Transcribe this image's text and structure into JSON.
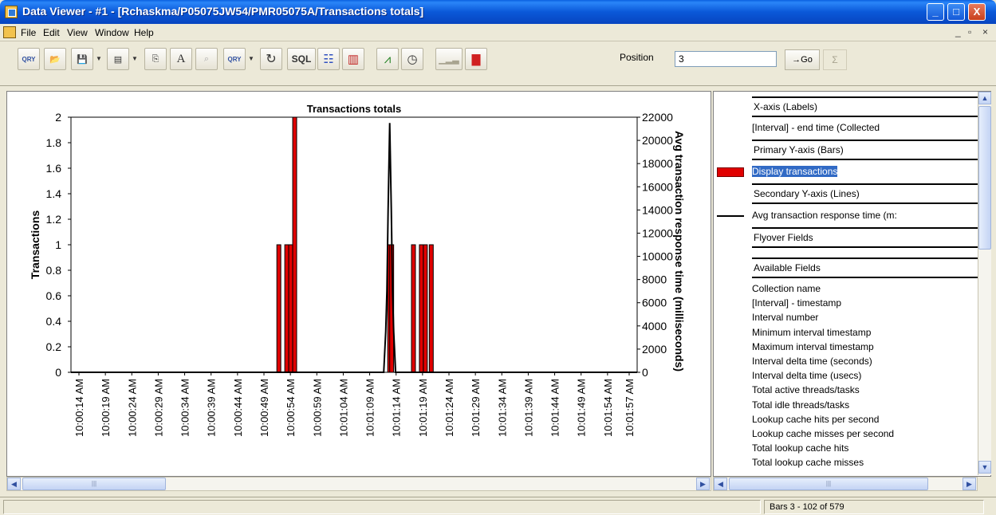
{
  "window": {
    "title": "Data Viewer - #1 - [Rchaskma/P05075JW54/PMR05075A/Transactions totals]",
    "minimize_glyph": "_",
    "maximize_glyph": "□",
    "close_glyph": "X"
  },
  "menu": {
    "items": [
      "File",
      "Edit",
      "View",
      "Window",
      "Help"
    ],
    "mdi_controls": [
      "_",
      "▫",
      "×"
    ]
  },
  "toolbar": {
    "buttons": [
      {
        "name": "query-button",
        "glyph": "QRY"
      },
      {
        "name": "open-button",
        "glyph": "📂"
      },
      {
        "name": "save-button",
        "glyph": "💾"
      },
      {
        "name": "properties-button",
        "glyph": "▤"
      },
      {
        "name": "copy-button",
        "glyph": "⎘"
      },
      {
        "name": "font-button",
        "glyph": "A"
      },
      {
        "name": "find-button",
        "glyph": "⌕"
      },
      {
        "name": "query-options-button",
        "glyph": "QRY"
      },
      {
        "name": "refresh-button",
        "glyph": "↻"
      },
      {
        "name": "sql-button",
        "glyph": "SQL"
      },
      {
        "name": "table-view-button",
        "glyph": "☷"
      },
      {
        "name": "bar-chart-button",
        "glyph": "▥"
      },
      {
        "name": "line-chart-button",
        "glyph": "⩘"
      },
      {
        "name": "time-button",
        "glyph": "◷"
      },
      {
        "name": "histogram-button",
        "glyph": "▁▂▃"
      },
      {
        "name": "legend-toggle-button",
        "glyph": "▇"
      }
    ],
    "position_label": "Position",
    "position_value": "3",
    "go_label": "→Go",
    "sum_label": "Σ"
  },
  "chart_data": {
    "type": "bar",
    "title": "Transactions totals",
    "ylabel": "Transactions",
    "y2label": "Avg transaction response time (milliseconds)",
    "ylim": [
      0,
      2
    ],
    "y2lim": [
      0,
      22000
    ],
    "yticks": [
      "0",
      "0.2",
      "0.4",
      "0.6",
      "0.8",
      "1",
      "1.2",
      "1.4",
      "1.6",
      "1.8",
      "2"
    ],
    "y2ticks": [
      "0",
      "2000",
      "4000",
      "6000",
      "8000",
      "10000",
      "12000",
      "14000",
      "16000",
      "18000",
      "20000",
      "22000"
    ],
    "xticks": [
      "10:00:14 AM",
      "10:00:19 AM",
      "10:00:24 AM",
      "10:00:29 AM",
      "10:00:34 AM",
      "10:00:39 AM",
      "10:00:44 AM",
      "10:00:49 AM",
      "10:00:54 AM",
      "10:00:59 AM",
      "10:01:04 AM",
      "10:01:09 AM",
      "10:01:14 AM",
      "10:01:19 AM",
      "10:01:24 AM",
      "10:01:29 AM",
      "10:01:34 AM",
      "10:01:39 AM",
      "10:01:44 AM",
      "10:01:49 AM",
      "10:01:54 AM",
      "10:01:57 AM"
    ],
    "bar_color": "#e00000",
    "line_color": "#000000",
    "series": [
      {
        "name": "Display transactions",
        "kind": "bars",
        "points": [
          {
            "x": 52.0,
            "y": 1
          },
          {
            "x": 54.0,
            "y": 1
          },
          {
            "x": 55.0,
            "y": 1
          },
          {
            "x": 56.0,
            "y": 2
          },
          {
            "x": 80.0,
            "y": 1
          },
          {
            "x": 80.5,
            "y": 1
          },
          {
            "x": 86.0,
            "y": 1
          },
          {
            "x": 88.0,
            "y": 1
          },
          {
            "x": 89.0,
            "y": 1
          },
          {
            "x": 90.5,
            "y": 1
          }
        ]
      },
      {
        "name": "Avg transaction response time (milliseconds)",
        "kind": "line",
        "points": [
          {
            "x": 0,
            "y": 0
          },
          {
            "x": 79.0,
            "y": 0
          },
          {
            "x": 79.5,
            "y": 3500
          },
          {
            "x": 79.8,
            "y": 7000
          },
          {
            "x": 80.1,
            "y": 14000
          },
          {
            "x": 80.5,
            "y": 21500
          },
          {
            "x": 80.9,
            "y": 14000
          },
          {
            "x": 81.2,
            "y": 7000
          },
          {
            "x": 81.5,
            "y": 3500
          },
          {
            "x": 82.0,
            "y": 0
          },
          {
            "x": 143,
            "y": 0
          }
        ]
      }
    ]
  },
  "fields": {
    "xaxis_header": "X-axis (Labels)",
    "xaxis_value": "[Interval] - end time (Collected",
    "primary_header": "Primary Y-axis (Bars)",
    "primary_value": "Display transactions",
    "secondary_header": "Secondary Y-axis (Lines)",
    "secondary_value": "Avg transaction response time (m:",
    "flyover_header": "Flyover Fields",
    "available_header": "Available Fields",
    "available": [
      "Collection name",
      "[Interval] - timestamp",
      "Interval number",
      "Minimum interval timestamp",
      "Maximum interval timestamp",
      "Interval delta time (seconds)",
      "Interval delta time (usecs)",
      "Total active threads/tasks",
      "Total idle threads/tasks",
      "Lookup cache hits per second",
      "Lookup cache misses per second",
      "Total lookup cache hits",
      "Total lookup cache misses"
    ]
  },
  "status": {
    "left": "",
    "bars": "Bars 3 - 102 of 579"
  },
  "scroll": {
    "thumb_grip": "|||"
  }
}
